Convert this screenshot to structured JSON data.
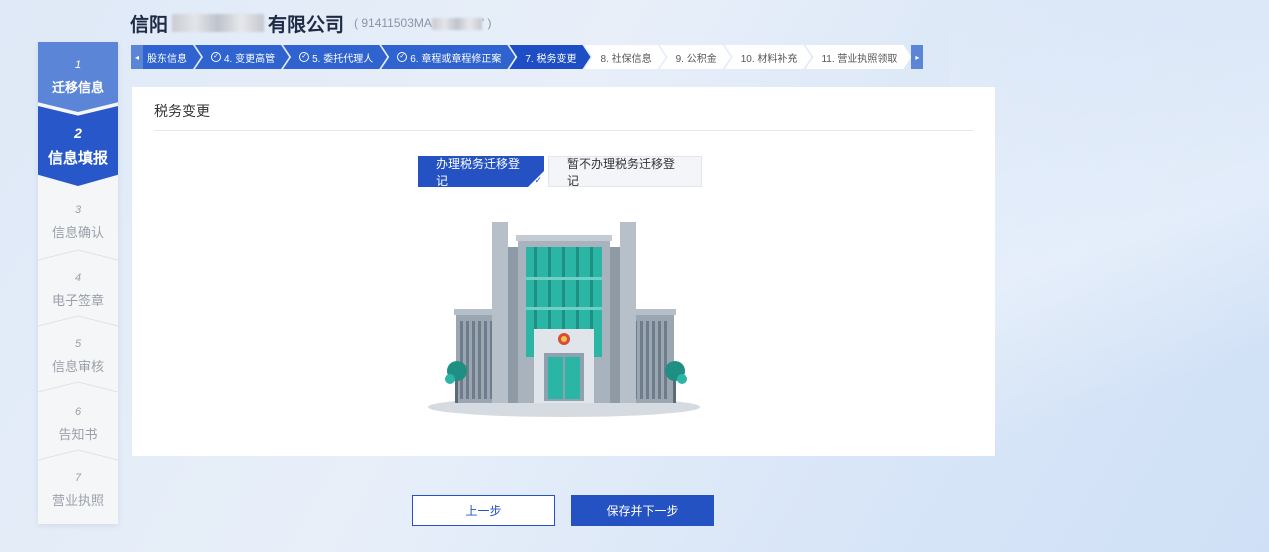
{
  "header": {
    "company_prefix": "信阳",
    "company_suffix": "有限公司",
    "credit_code": "( 91411503MA",
    "credit_code_end": "' )"
  },
  "sidebar": {
    "steps": [
      {
        "num": "1",
        "label": "迁移信息",
        "state": "done"
      },
      {
        "num": "2",
        "label": "信息填报",
        "state": "active"
      },
      {
        "num": "3",
        "label": "信息确认",
        "state": "todo"
      },
      {
        "num": "4",
        "label": "电子签章",
        "state": "todo"
      },
      {
        "num": "5",
        "label": "信息审核",
        "state": "todo"
      },
      {
        "num": "6",
        "label": "告知书",
        "state": "todo"
      },
      {
        "num": "7",
        "label": "营业执照",
        "state": "todo"
      }
    ]
  },
  "tabs": {
    "scroll_left": "◂",
    "scroll_right": "▸",
    "items": [
      {
        "label": "股东信息",
        "state": "done"
      },
      {
        "label": "4. 变更高管",
        "state": "done"
      },
      {
        "label": "5. 委托代理人",
        "state": "done"
      },
      {
        "label": "6. 章程或章程修正案",
        "state": "done"
      },
      {
        "label": "7. 税务变更",
        "state": "cur"
      },
      {
        "label": "8. 社保信息",
        "state": "todo"
      },
      {
        "label": "9. 公积金",
        "state": "todo"
      },
      {
        "label": "10. 材料补充",
        "state": "todo"
      },
      {
        "label": "11. 营业执照领取",
        "state": "todo"
      }
    ]
  },
  "card": {
    "title": "税务变更",
    "options": {
      "selected": "办理税务迁移登记",
      "unselected": "暂不办理税务迁移登记"
    }
  },
  "buttons": {
    "prev": "上一步",
    "next": "保存并下一步"
  },
  "colors": {
    "primary": "#2552c3",
    "tab_done": "#2f63cf",
    "sidebar_done": "#5b85d6",
    "building_teal": "#2bb5a5"
  }
}
